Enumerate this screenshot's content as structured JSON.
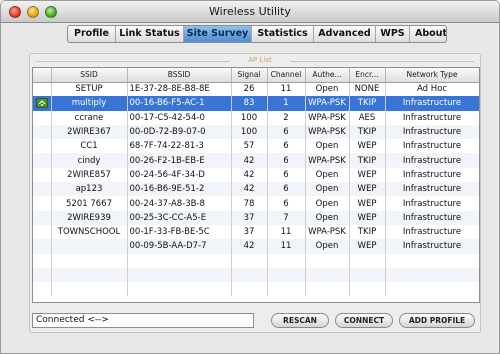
{
  "window": {
    "title": "Wireless Utility"
  },
  "tabs": [
    "Profile",
    "Link Status",
    "Site Survey",
    "Statistics",
    "Advanced",
    "WPS",
    "About"
  ],
  "active_tab": "Site Survey",
  "group": {
    "title": "AP List"
  },
  "table": {
    "columns": [
      "",
      "SSID",
      "BSSID",
      "Signal",
      "Channel",
      "Authe...",
      "Encr...",
      "Network Type"
    ],
    "rows": [
      {
        "ssid": "SETUP",
        "bssid": "1E-37-28-8E-B8-8E",
        "signal": "26",
        "channel": "11",
        "auth": "Open",
        "enc": "NONE",
        "type": "Ad Hoc",
        "icon": ""
      },
      {
        "ssid": "multiply",
        "bssid": "00-16-B6-F5-AC-1",
        "signal": "83",
        "channel": "1",
        "auth": "WPA-PSK",
        "enc": "TKIP",
        "type": "Infrastructure",
        "icon": "connected-network-icon"
      },
      {
        "ssid": "ccrane",
        "bssid": "00-17-C5-42-54-0",
        "signal": "100",
        "channel": "2",
        "auth": "WPA-PSK",
        "enc": "AES",
        "type": "Infrastructure",
        "icon": ""
      },
      {
        "ssid": "2WIRE367",
        "bssid": "00-0D-72-B9-07-0",
        "signal": "100",
        "channel": "6",
        "auth": "WPA-PSK",
        "enc": "TKIP",
        "type": "Infrastructure",
        "icon": ""
      },
      {
        "ssid": "CC1",
        "bssid": "68-7F-74-22-81-3",
        "signal": "57",
        "channel": "6",
        "auth": "Open",
        "enc": "WEP",
        "type": "Infrastructure",
        "icon": ""
      },
      {
        "ssid": "cindy",
        "bssid": "00-26-F2-1B-EB-E",
        "signal": "42",
        "channel": "6",
        "auth": "WPA-PSK",
        "enc": "TKIP",
        "type": "Infrastructure",
        "icon": ""
      },
      {
        "ssid": "2WIRE857",
        "bssid": "00-24-56-4F-34-D",
        "signal": "42",
        "channel": "6",
        "auth": "Open",
        "enc": "WEP",
        "type": "Infrastructure",
        "icon": ""
      },
      {
        "ssid": "ap123",
        "bssid": "00-16-B6-9E-51-2",
        "signal": "42",
        "channel": "6",
        "auth": "Open",
        "enc": "WEP",
        "type": "Infrastructure",
        "icon": ""
      },
      {
        "ssid": "5201 7667",
        "bssid": "00-24-37-A8-3B-8",
        "signal": "78",
        "channel": "6",
        "auth": "Open",
        "enc": "WEP",
        "type": "Infrastructure",
        "icon": ""
      },
      {
        "ssid": "2WIRE939",
        "bssid": "00-25-3C-CC-A5-E",
        "signal": "37",
        "channel": "7",
        "auth": "Open",
        "enc": "WEP",
        "type": "Infrastructure",
        "icon": ""
      },
      {
        "ssid": "TOWNSCHOOL",
        "bssid": "00-1F-33-FB-BE-5C",
        "signal": "37",
        "channel": "11",
        "auth": "WPA-PSK",
        "enc": "TKIP",
        "type": "Infrastructure",
        "icon": ""
      },
      {
        "ssid": "",
        "bssid": "00-09-5B-AA-D7-7",
        "signal": "42",
        "channel": "11",
        "auth": "Open",
        "enc": "WEP",
        "type": "Infrastructure",
        "icon": ""
      }
    ],
    "selected_index": 1,
    "empty_rows": 3
  },
  "status": {
    "text": "Connected <-->"
  },
  "buttons": {
    "rescan": "RESCAN",
    "connect": "CONNECT",
    "add_profile": "ADD PROFILE"
  },
  "colors": {
    "selection": "#3875d7",
    "active_tab": "#5b99d6"
  }
}
